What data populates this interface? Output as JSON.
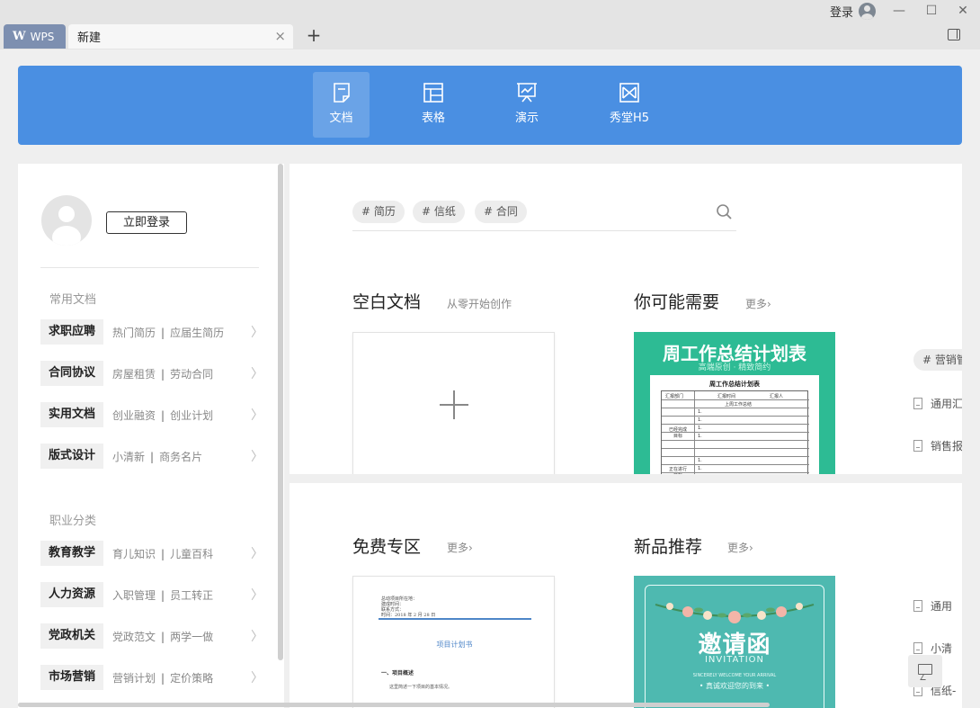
{
  "titlebar": {
    "app_tab": "WPS",
    "app_logo": "W",
    "doc_tab": "新建",
    "close_glyph": "×",
    "add_glyph": "+",
    "login": "登录",
    "minimize": "—",
    "maximize": "☐",
    "close": "✕"
  },
  "nav": {
    "items": [
      {
        "label": "文档",
        "icon": "document-icon",
        "active": true
      },
      {
        "label": "表格",
        "icon": "spreadsheet-icon",
        "active": false
      },
      {
        "label": "演示",
        "icon": "presentation-icon",
        "active": false
      },
      {
        "label": "秀堂H5",
        "icon": "h5-icon",
        "active": false
      }
    ],
    "color": "#4a8fe2"
  },
  "left": {
    "login_button": "立即登录",
    "section1": "常用文档",
    "section2": "职业分类",
    "categories": [
      {
        "tag": "求职应聘",
        "links": [
          "热门简历",
          "应届生简历"
        ]
      },
      {
        "tag": "合同协议",
        "links": [
          "房屋租赁",
          "劳动合同"
        ]
      },
      {
        "tag": "实用文档",
        "links": [
          "创业融资",
          "创业计划"
        ]
      },
      {
        "tag": "版式设计",
        "links": [
          "小清新",
          "商务名片"
        ]
      }
    ],
    "careers": [
      {
        "tag": "教育教学",
        "links": [
          "育儿知识",
          "儿童百科"
        ]
      },
      {
        "tag": "人力资源",
        "links": [
          "入职管理",
          "员工转正"
        ]
      },
      {
        "tag": "党政机关",
        "links": [
          "党政范文",
          "两学一做"
        ]
      },
      {
        "tag": "市场营销",
        "links": [
          "营销计划",
          "定价策略"
        ]
      }
    ],
    "separator": "|",
    "arrow": "〉"
  },
  "search": {
    "tags": [
      "# 简历",
      "# 信纸",
      "# 合同"
    ]
  },
  "blank": {
    "title": "空白文档",
    "subtitle": "从零开始创作"
  },
  "maybe": {
    "title": "你可能需要",
    "more": "更多›"
  },
  "weekly_template": {
    "title": "周工作总结计划表",
    "subtitle": "高端原创 · 精致简约",
    "sheet_title": "周工作总结计划表",
    "headers": [
      "汇报部门",
      "汇报时间",
      "汇报人"
    ],
    "section": "上周工作总结",
    "row_done": "已经完成\n目标",
    "row_pending": "正在进行\n目标",
    "bullet": "1."
  },
  "right_col": {
    "tag": "# 营销管",
    "items_top": [
      "通用汇",
      "销售报"
    ],
    "items_bottom": [
      "通用",
      "小清",
      "信纸-"
    ]
  },
  "free": {
    "title": "免费专区",
    "more": "更多›"
  },
  "new": {
    "title": "新品推荐",
    "more": "更多›"
  },
  "plan_template": {
    "lines": [
      "总动项目所在地：",
      "建成时间：",
      "联系方式：",
      "时间：2018 年 2 月 28 日"
    ],
    "title": "项目计划书",
    "heading": "一、项目概述",
    "para": "这里简述一下项目的基本情况。"
  },
  "invite_template": {
    "title": "邀请函",
    "en": "INVITATION",
    "sub1": "SINCERELY WELCOME YOUR ARRIVAL",
    "sub2": "• 真诚欢迎您的到来 •"
  }
}
